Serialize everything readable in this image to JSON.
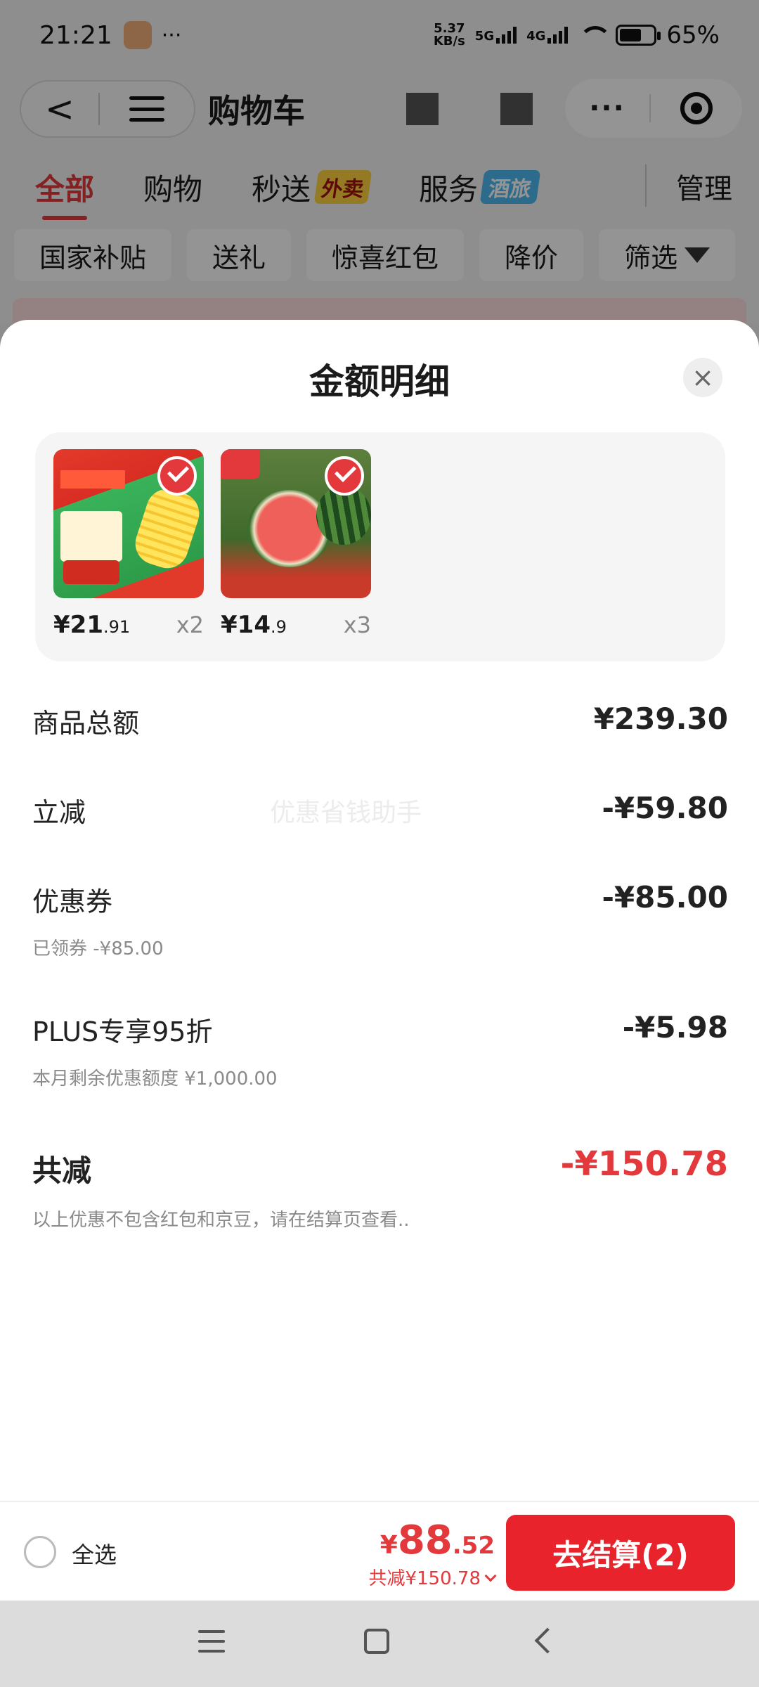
{
  "status_bar": {
    "time": "21:21",
    "more": "···",
    "net_speed_value": "5.37",
    "net_speed_unit": "KB/s",
    "sig1": "5G",
    "sig2": "4G",
    "battery": "65%"
  },
  "header": {
    "back_label": "<",
    "title": "购物车"
  },
  "tabs": [
    {
      "label": "全部",
      "active": true
    },
    {
      "label": "购物"
    },
    {
      "label": "秒送",
      "tag": "外卖"
    },
    {
      "label": "服务",
      "tag": "酒旅"
    }
  ],
  "manage_label": "管理",
  "chips": [
    "国家补贴",
    "送礼",
    "惊喜红包",
    "降价",
    "筛选"
  ],
  "sheet": {
    "title": "金额明细",
    "close_label": "×",
    "goods": [
      {
        "price_int": "¥21",
        "price_dec": ".91",
        "qty": "x2",
        "icon": "corn-product-image"
      },
      {
        "price_int": "¥14",
        "price_dec": ".9",
        "qty": "x3",
        "icon": "watermelon-product-image"
      }
    ],
    "rows": {
      "subtotal": {
        "label": "商品总额",
        "value": "¥239.30"
      },
      "instant": {
        "label": "立减",
        "value": "-¥59.80"
      },
      "coupon": {
        "label": "优惠券",
        "value": "-¥85.00",
        "sub": "已领券 -¥85.00"
      },
      "plus": {
        "label": "PLUS专享95折",
        "value": "-¥5.98",
        "sub": "本月剩余优惠额度 ¥1,000.00"
      },
      "total": {
        "label": "共减",
        "value": "-¥150.78",
        "sub": "以上优惠不包含红包和京豆，请在结算页查看.."
      }
    },
    "watermark": "优惠省钱助手"
  },
  "checkout": {
    "select_all": "全选",
    "yen": "¥",
    "amount_int": "88",
    "amount_dec": ".52",
    "reduce_text": "共减¥150.78",
    "pay_button": "去结算(2)"
  },
  "colors": {
    "accent": "#e4393c",
    "pay_button": "#e8232b"
  }
}
